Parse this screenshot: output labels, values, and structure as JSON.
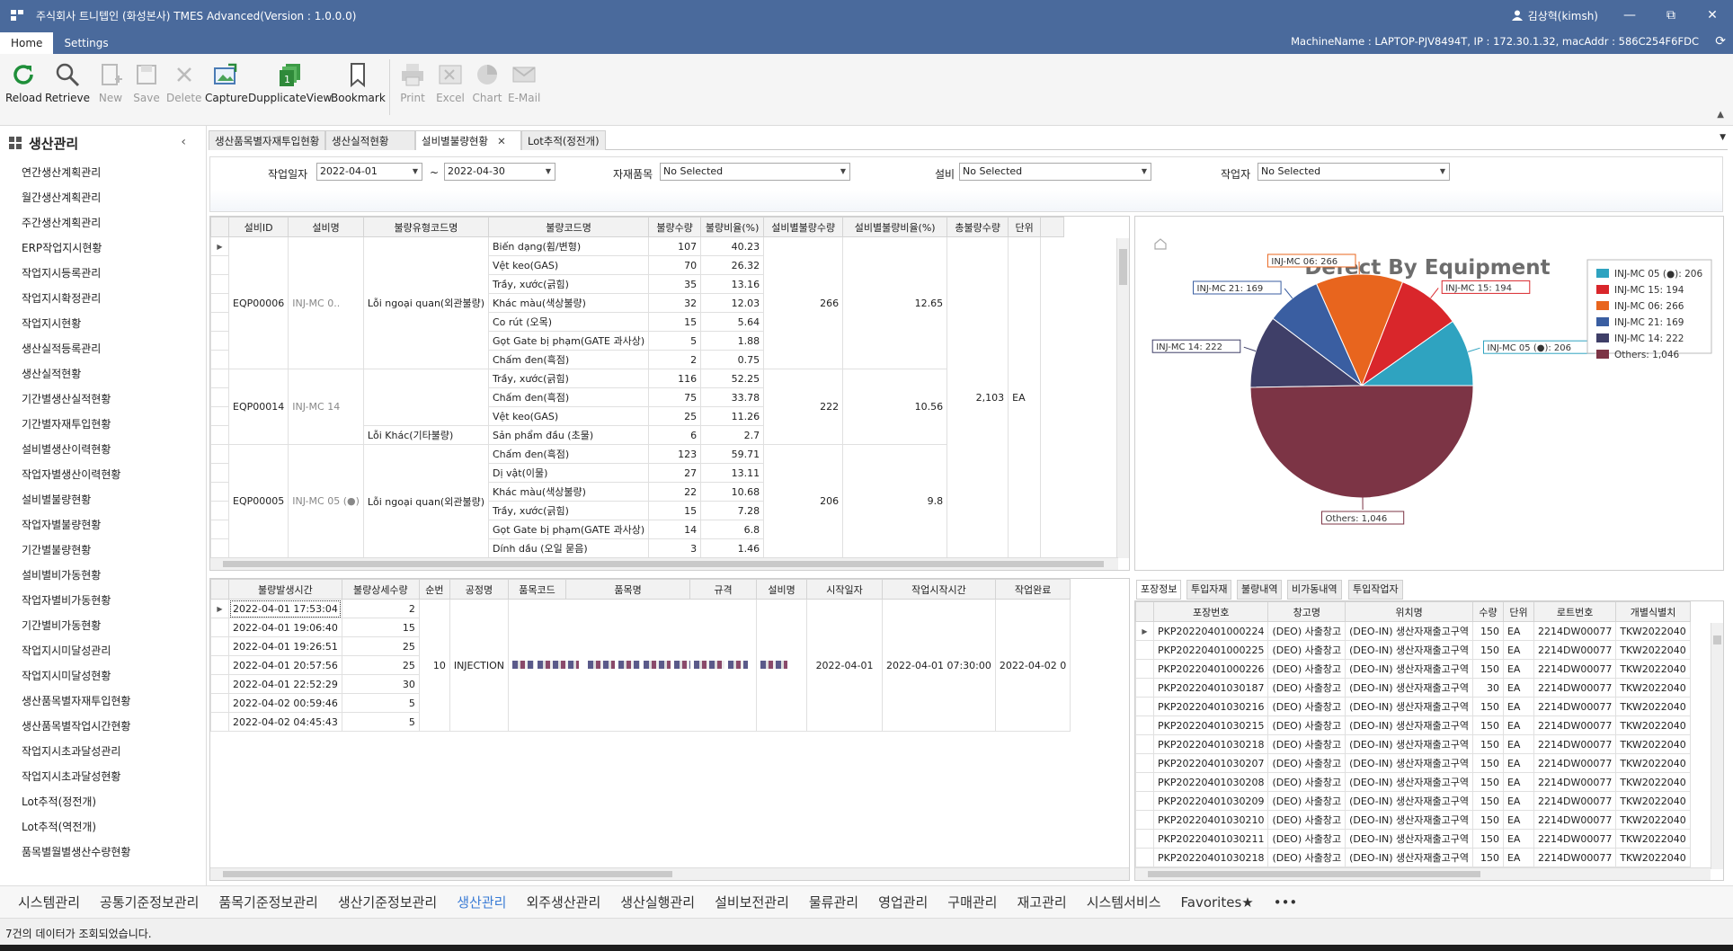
{
  "window": {
    "title": "주식회사 트니텝인 (화성본사) TMES Advanced(Version : 1.0.0.0)",
    "user": "김상혁(kimsh)",
    "minimize": "—",
    "maximize": "⧉",
    "close": "✕"
  },
  "ribbon": {
    "tabs": [
      {
        "label": "Home"
      },
      {
        "label": "Settings"
      }
    ],
    "machine_info": "MachineName : LAPTOP-PJV8494T, IP : 172.30.1.32, macAddr : 586C254F6FDC",
    "buttons": [
      {
        "label": "Reload",
        "icon": "reload-icon",
        "enabled": true
      },
      {
        "label": "Retrieve",
        "icon": "search-icon",
        "enabled": true
      },
      {
        "label": "New",
        "icon": "new-document-icon",
        "enabled": false
      },
      {
        "label": "Save",
        "icon": "save-icon",
        "enabled": false
      },
      {
        "label": "Delete",
        "icon": "delete-icon",
        "enabled": false
      },
      {
        "label": "Capture",
        "icon": "capture-icon",
        "enabled": true
      },
      {
        "label": "DupplicateView",
        "icon": "duplicate-view-icon",
        "enabled": true
      },
      {
        "label": "Bookmark",
        "icon": "bookmark-icon",
        "enabled": true
      },
      {
        "label": "Print",
        "icon": "print-icon",
        "enabled": false
      },
      {
        "label": "Excel",
        "icon": "excel-icon",
        "enabled": false
      },
      {
        "label": "Chart",
        "icon": "chart-icon",
        "enabled": false
      },
      {
        "label": "E-Mail",
        "icon": "email-icon",
        "enabled": false
      }
    ]
  },
  "sidebar": {
    "title": "생산관리",
    "items": [
      {
        "label": "연간생산계획관리"
      },
      {
        "label": "월간생산계획관리"
      },
      {
        "label": "주간생산계획관리"
      },
      {
        "label": "ERP작업지시현황"
      },
      {
        "label": "작업지시등록관리"
      },
      {
        "label": "작업지시확정관리"
      },
      {
        "label": "작업지시현황"
      },
      {
        "label": "생산실적등록관리"
      },
      {
        "label": "생산실적현황"
      },
      {
        "label": "기간별생산실적현황"
      },
      {
        "label": "기간별자재투입현황"
      },
      {
        "label": "설비별생산이력현황"
      },
      {
        "label": "작업자별생산이력현황"
      },
      {
        "label": "설비별불량현황"
      },
      {
        "label": "작업자별불량현황"
      },
      {
        "label": "기간별불량현황"
      },
      {
        "label": "설비별비가동현황"
      },
      {
        "label": "작업자별비가동현황"
      },
      {
        "label": "기간별비가동현황"
      },
      {
        "label": "작업지시미달성관리"
      },
      {
        "label": "작업지시미달성현황"
      },
      {
        "label": "생산품목별자재투입현황"
      },
      {
        "label": "생산품목별작업시간현황"
      },
      {
        "label": "작업지시초과달성관리"
      },
      {
        "label": "작업지시초과달성현황"
      },
      {
        "label": "Lot추적(정전개)"
      },
      {
        "label": "Lot추적(역전개)"
      },
      {
        "label": "품목별월별생산수량현황"
      }
    ]
  },
  "doc_tabs": [
    {
      "label": "생산품목별자재투입현황"
    },
    {
      "label": "생산실적현황"
    },
    {
      "label": "설비별불량현황",
      "close": "✕"
    },
    {
      "label": "Lot추적(정전개)"
    }
  ],
  "filter": {
    "date_label": "작업일자",
    "date_from": "2022-04-01",
    "tilde": "~",
    "date_to": "2022-04-30",
    "material_label": "자재품목",
    "material_value": "No Selected",
    "equipment_label": "설비",
    "equipment_value": "No Selected",
    "worker_label": "작업자",
    "worker_value": "No Selected"
  },
  "main_grid": {
    "headers": [
      "설비ID",
      "설비명",
      "불량유형코드명",
      "불량코드명",
      "불량수량",
      "불량비율(%)",
      "설비별불량수량",
      "설비별불량비율(%)",
      "총불량수량",
      "단위"
    ],
    "groups": [
      {
        "id": "EQP00006",
        "name": "INJ-MC 0..",
        "equip_qty": "266",
        "equip_rate": "12.65",
        "types": [
          {
            "type": "Lỗi ngoại quan(외관불량)",
            "rows": [
              [
                "Biến dạng(휨/변형)",
                "107",
                "40.23"
              ],
              [
                "Vệt keo(GAS)",
                "70",
                "26.32"
              ],
              [
                "Trầy, xước(긁힘)",
                "35",
                "13.16"
              ],
              [
                "Khác màu(색상불량)",
                "32",
                "12.03"
              ],
              [
                "Co rút (오목)",
                "15",
                "5.64"
              ],
              [
                "Gọt Gate bị phạm(GATE 과사상)",
                "5",
                "1.88"
              ],
              [
                "Chấm đen(흑점)",
                "2",
                "0.75"
              ]
            ]
          }
        ]
      },
      {
        "id": "EQP00014",
        "name": "INJ-MC 14",
        "equip_qty": "222",
        "equip_rate": "10.56",
        "types": [
          {
            "type": "",
            "rows": [
              [
                "Trầy, xước(긁힘)",
                "116",
                "52.25"
              ],
              [
                "Chấm đen(흑점)",
                "75",
                "33.78"
              ],
              [
                "Vệt keo(GAS)",
                "25",
                "11.26"
              ]
            ]
          },
          {
            "type": "Lỗi Khác(기타불량)",
            "rows": [
              [
                "Sản phẩm đầu (초물)",
                "6",
                "2.7"
              ]
            ]
          }
        ]
      },
      {
        "id": "EQP00005",
        "name": "INJ-MC 05 (●)",
        "equip_qty": "206",
        "equip_rate": "9.8",
        "types": [
          {
            "type": "Lỗi ngoại quan(외관불량)",
            "rows": [
              [
                "Chấm đen(흑점)",
                "123",
                "59.71"
              ],
              [
                "Dị vật(이물)",
                "27",
                "13.11"
              ],
              [
                "Khác màu(색상불량)",
                "22",
                "10.68"
              ],
              [
                "Trầy, xước(긁힘)",
                "15",
                "7.28"
              ],
              [
                "Gọt Gate bị phạm(GATE 과사상)",
                "14",
                "6.8"
              ],
              [
                "Dính dầu (오일 묻음)",
                "3",
                "1.46"
              ]
            ]
          }
        ]
      }
    ],
    "total_qty": "2,103",
    "unit": "EA"
  },
  "chart_data": {
    "type": "pie",
    "title": "Defect By Equipment",
    "labels": [
      "INJ-MC 05 (●)",
      "INJ-MC 15",
      "INJ-MC 06",
      "INJ-MC 21",
      "INJ-MC 14",
      "Others"
    ],
    "values": [
      206,
      194,
      266,
      169,
      222,
      1046
    ],
    "callouts": [
      "INJ-MC 05 (●): 206",
      "INJ-MC 15: 194",
      "INJ-MC 06: 266",
      "INJ-MC 21: 169",
      "INJ-MC 14: 222",
      "Others: 1,046"
    ],
    "legend": [
      "INJ-MC 05 (●): 206",
      "INJ-MC 15: 194",
      "INJ-MC 06: 266",
      "INJ-MC 21: 169",
      "INJ-MC 14: 222",
      "Others: 1,046"
    ],
    "colors": [
      "#2fa3c0",
      "#d9262b",
      "#e8651e",
      "#3a5ea1",
      "#3f3f68",
      "#7c3445"
    ],
    "legend_position": "right"
  },
  "detail_grid": {
    "headers": [
      "불량발생시간",
      "불량상세수량",
      "순번",
      "공정명",
      "품목코드",
      "품목명",
      "규격",
      "설비명",
      "시작일자",
      "작업시작시간",
      "작업완료"
    ],
    "rows": [
      [
        "2022-04-01 17:53:04",
        "2"
      ],
      [
        "2022-04-01 19:06:40",
        "15"
      ],
      [
        "2022-04-01 19:26:51",
        "25"
      ],
      [
        "2022-04-01 20:57:56",
        "25"
      ],
      [
        "2022-04-01 22:52:29",
        "30"
      ],
      [
        "2022-04-02 00:59:46",
        "5"
      ],
      [
        "2022-04-02 04:45:43",
        "5"
      ]
    ],
    "seq": "10",
    "process": "INJECTION",
    "start_date": "2022-04-01",
    "start_time": "2022-04-01 07:30:00",
    "end_time": "2022-04-02 0"
  },
  "pack_tabs": [
    {
      "label": "포장정보"
    },
    {
      "label": "투입자재"
    },
    {
      "label": "불량내역"
    },
    {
      "label": "비가동내역"
    },
    {
      "label": "투입작업자"
    }
  ],
  "pack_grid": {
    "headers": [
      "포장번호",
      "창고명",
      "위치명",
      "수량",
      "단위",
      "로트번호",
      "개별식별치"
    ],
    "rows": [
      [
        "PKP20220401000224",
        "(DEO) 사출창고",
        "(DEO-IN) 생산자재출고구역",
        "150",
        "EA",
        "2214DW00077",
        "TKW2022040"
      ],
      [
        "PKP20220401000225",
        "(DEO) 사출창고",
        "(DEO-IN) 생산자재출고구역",
        "150",
        "EA",
        "2214DW00077",
        "TKW2022040"
      ],
      [
        "PKP20220401000226",
        "(DEO) 사출창고",
        "(DEO-IN) 생산자재출고구역",
        "150",
        "EA",
        "2214DW00077",
        "TKW2022040"
      ],
      [
        "PKP20220401030187",
        "(DEO) 사출창고",
        "(DEO-IN) 생산자재출고구역",
        "30",
        "EA",
        "2214DW00077",
        "TKW2022040"
      ],
      [
        "PKP20220401030216",
        "(DEO) 사출창고",
        "(DEO-IN) 생산자재출고구역",
        "150",
        "EA",
        "2214DW00077",
        "TKW2022040"
      ],
      [
        "PKP20220401030215",
        "(DEO) 사출창고",
        "(DEO-IN) 생산자재출고구역",
        "150",
        "EA",
        "2214DW00077",
        "TKW2022040"
      ],
      [
        "PKP20220401030218",
        "(DEO) 사출창고",
        "(DEO-IN) 생산자재출고구역",
        "150",
        "EA",
        "2214DW00077",
        "TKW2022040"
      ],
      [
        "PKP20220401030207",
        "(DEO) 사출창고",
        "(DEO-IN) 생산자재출고구역",
        "150",
        "EA",
        "2214DW00077",
        "TKW2022040"
      ],
      [
        "PKP20220401030208",
        "(DEO) 사출창고",
        "(DEO-IN) 생산자재출고구역",
        "150",
        "EA",
        "2214DW00077",
        "TKW2022040"
      ],
      [
        "PKP20220401030209",
        "(DEO) 사출창고",
        "(DEO-IN) 생산자재출고구역",
        "150",
        "EA",
        "2214DW00077",
        "TKW2022040"
      ],
      [
        "PKP20220401030210",
        "(DEO) 사출창고",
        "(DEO-IN) 생산자재출고구역",
        "150",
        "EA",
        "2214DW00077",
        "TKW2022040"
      ],
      [
        "PKP20220401030211",
        "(DEO) 사출창고",
        "(DEO-IN) 생산자재출고구역",
        "150",
        "EA",
        "2214DW00077",
        "TKW2022040"
      ],
      [
        "PKP20220401030218",
        "(DEO) 사출창고",
        "(DEO-IN) 생산자재출고구역",
        "150",
        "EA",
        "2214DW00077",
        "TKW2022040"
      ]
    ]
  },
  "modules": [
    {
      "label": "시스템관리"
    },
    {
      "label": "공통기준정보관리"
    },
    {
      "label": "품목기준정보관리"
    },
    {
      "label": "생산기준정보관리"
    },
    {
      "label": "생산관리",
      "active": true
    },
    {
      "label": "외주생산관리"
    },
    {
      "label": "생산실행관리"
    },
    {
      "label": "설비보전관리"
    },
    {
      "label": "물류관리"
    },
    {
      "label": "영업관리"
    },
    {
      "label": "구매관리"
    },
    {
      "label": "재고관리"
    },
    {
      "label": "시스템서비스"
    },
    {
      "label": "Favorites★"
    },
    {
      "label": "•••"
    }
  ],
  "status": "7건의 데이터가 조회되었습니다."
}
